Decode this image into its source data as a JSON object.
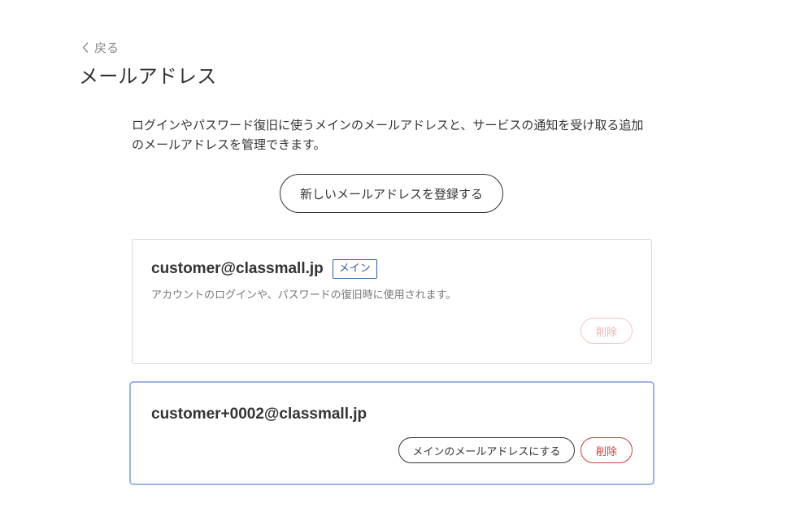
{
  "nav": {
    "back_label": "戻る"
  },
  "page": {
    "title": "メールアドレス",
    "description": "ログインやパスワード復旧に使うメインのメールアドレスと、サービスの通知を受け取る追加のメールアドレスを管理できます。",
    "register_button_label": "新しいメールアドレスを登録する"
  },
  "emails": [
    {
      "address": "customer@classmall.jp",
      "badge": "メイン",
      "note": "アカウントのログインや、パスワードの復旧時に使用されます。",
      "delete_label": "削除",
      "delete_enabled": false
    },
    {
      "address": "customer+0002@classmall.jp",
      "set_main_label": "メインのメールアドレスにする",
      "delete_label": "削除",
      "delete_enabled": true
    }
  ],
  "icons": {
    "back": "chevron-left-icon"
  },
  "colors": {
    "text": "#333333",
    "muted_text": "#777777",
    "badge_blue": "#2f5fa8",
    "danger_red": "#c9413b",
    "danger_red_disabled": "#efb3ad",
    "focus_border": "#9bb5e4",
    "card_border": "#d9d9d9"
  }
}
